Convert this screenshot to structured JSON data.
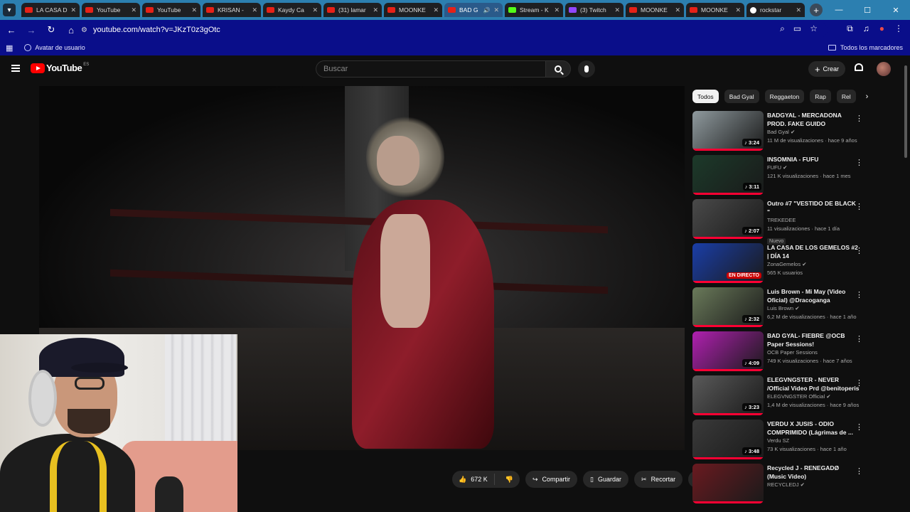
{
  "browser": {
    "tabs": [
      {
        "title": "LA CASA D",
        "icon": "youtube-icon"
      },
      {
        "title": "YouTube",
        "icon": "youtube-icon"
      },
      {
        "title": "YouTube",
        "icon": "youtube-icon"
      },
      {
        "title": "KRISAN -",
        "icon": "youtube-icon"
      },
      {
        "title": "Kaydy Ca",
        "icon": "youtube-icon"
      },
      {
        "title": "(31) lamar",
        "icon": "youtube-icon"
      },
      {
        "title": "MOONKE",
        "icon": "youtube-icon"
      },
      {
        "title": "BAD G",
        "icon": "youtube-icon",
        "active": true
      },
      {
        "title": "Stream - K",
        "icon": "kick-icon"
      },
      {
        "title": "(3) Twitch",
        "icon": "twitch-icon"
      },
      {
        "title": "MOONKE",
        "icon": "youtube-icon"
      },
      {
        "title": "MOONKE",
        "icon": "youtube-icon"
      },
      {
        "title": "rockstar",
        "icon": "google-icon"
      }
    ],
    "url": "youtube.com/watch?v=JKzT0z3gOtc",
    "bookmarks": {
      "item": "Avatar de usuario",
      "all": "Todos los marcadores"
    }
  },
  "youtube": {
    "logo_text": "YouTube",
    "logo_country": "ES",
    "search_placeholder": "Buscar",
    "create_label": "Crear",
    "actions": {
      "likes": "672 K",
      "share": "Compartir",
      "save": "Guardar",
      "clip": "Recortar"
    },
    "chips": [
      "Todos",
      "Bad Gyal",
      "Reggaeton",
      "Rap",
      "Rel"
    ],
    "recommendations": [
      {
        "title": "BADGYAL - MERCADONA PROD. FAKE GUIDO",
        "channel": "Bad Gyal",
        "verified": true,
        "stats": "11 M de visualizaciones · hace 9 años",
        "duration": "3:24",
        "thumb": "#8f9a9e"
      },
      {
        "title": "INSOMNIA - FUFU",
        "channel": "FUFU",
        "verified": true,
        "stats": "121 K visualizaciones · hace 1 mes",
        "duration": "3:11",
        "thumb": "#1c3a2a"
      },
      {
        "title": "Outro #7 \"VESTIDO DE BLACK \"",
        "channel": "TREKEDEE",
        "verified": false,
        "stats": "11 visualizaciones · hace 1 día",
        "duration": "2:07",
        "badge": "Nuevo",
        "thumb": "#4a4a4a"
      },
      {
        "title": "LA CASA DE LOS GEMELOS #2 | DÍA 14",
        "channel": "ZonaGemelos",
        "verified": true,
        "stats": "565 K usuarios",
        "live": "EN DIRECTO",
        "thumb": "#1a3ea8"
      },
      {
        "title": "Luis Brown - Mi May (Video Oficial) @Dracoganga",
        "channel": "Luis Brown",
        "verified": true,
        "stats": "6,2 M de visualizaciones · hace 1 año",
        "duration": "2:32",
        "thumb": "#6a7a5a"
      },
      {
        "title": "BAD GYAL- FIEBRE @OCB Paper Sessions!",
        "channel": "OCB Paper Sessions",
        "verified": false,
        "stats": "749 K visualizaciones · hace 7 años",
        "duration": "4:09",
        "thumb": "#b020b0"
      },
      {
        "title": "ELEGVNGSTER - NEVER /Official Video Prd @benitoperis",
        "channel": "ELEGVNGSTER Official",
        "verified": true,
        "stats": "1,4 M de visualizaciones · hace 9 años",
        "duration": "3:23",
        "thumb": "#5a5a5a"
      },
      {
        "title": "VERDU X JUSIS - ODIO COMPRIMIDO (Lágrimas de ...",
        "channel": "Verdu SZ",
        "verified": false,
        "stats": "73 K visualizaciones · hace 1 año",
        "duration": "3:48",
        "thumb": "#3a3a3a"
      },
      {
        "title": "Recycled J - RENEGADØ (Music Video)",
        "channel": "RECYCLEDJ",
        "verified": true,
        "stats": "",
        "thumb": "#6a1a20"
      }
    ]
  }
}
